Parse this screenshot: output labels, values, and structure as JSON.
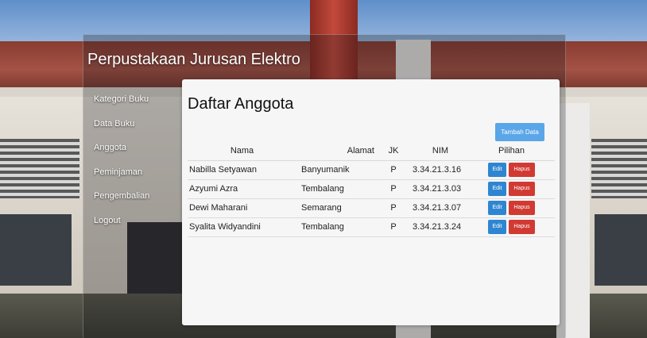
{
  "app": {
    "title": "Perpustakaan Jurusan Elektro"
  },
  "sidebar": {
    "items": [
      {
        "label": "Kategori Buku"
      },
      {
        "label": "Data Buku"
      },
      {
        "label": "Anggota"
      },
      {
        "label": "Peminjaman"
      },
      {
        "label": "Pengembalian"
      },
      {
        "label": "Logout"
      }
    ]
  },
  "main": {
    "heading": "Daftar Anggota",
    "add_button": "Tambah Data",
    "columns": [
      "Nama",
      "Alamat",
      "JK",
      "NIM",
      "Pilihan"
    ],
    "rows": [
      {
        "nama": "Nabilla Setyawan",
        "alamat": "Banyumanik",
        "jk": "P",
        "nim": "3.34.21.3.16"
      },
      {
        "nama": "Azyumi Azra",
        "alamat": "Tembalang",
        "jk": "P",
        "nim": "3.34.21.3.03"
      },
      {
        "nama": "Dewi Maharani",
        "alamat": "Semarang",
        "jk": "P",
        "nim": "3.34.21.3.07"
      },
      {
        "nama": "Syalita Widyandini",
        "alamat": "Tembalang",
        "jk": "P",
        "nim": "3.34.21.3.24"
      }
    ],
    "edit_label": "Edit",
    "delete_label": "Hapus"
  },
  "colors": {
    "edit": "#2e86d1",
    "delete": "#d03a32",
    "add": "#5aa6e8"
  }
}
